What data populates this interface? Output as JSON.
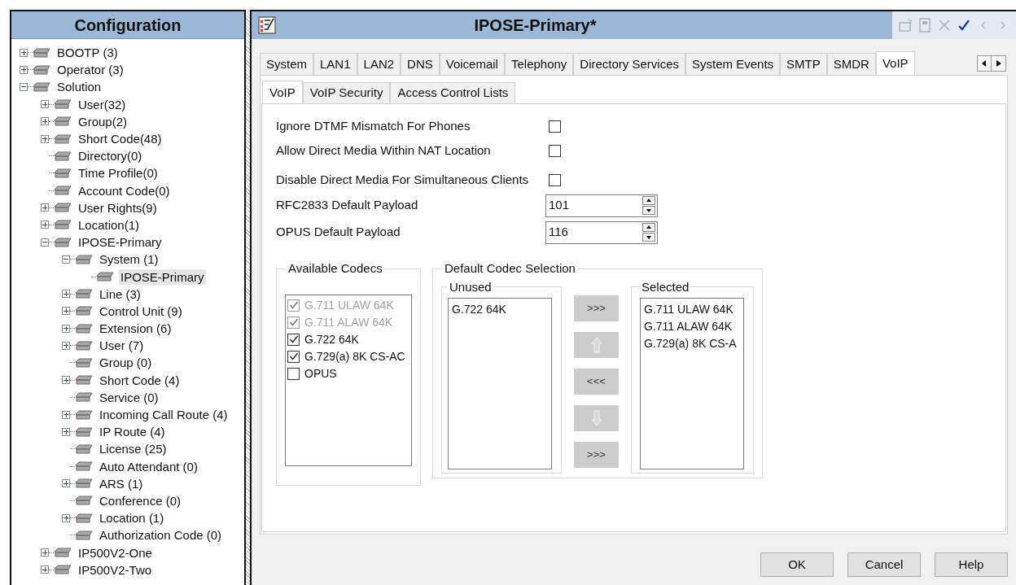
{
  "left_panel": {
    "title": "Configuration",
    "tree": [
      {
        "label": "BOOTP (3)",
        "expanded": false,
        "selected": false
      },
      {
        "label": "Operator (3)",
        "expanded": false,
        "selected": false
      },
      {
        "label": "Solution",
        "expanded": true,
        "selected": false,
        "children": [
          {
            "label": "User(32)",
            "expanded": false,
            "selected": false
          },
          {
            "label": "Group(2)",
            "expanded": false,
            "selected": false
          },
          {
            "label": "Short Code(48)",
            "expanded": false,
            "selected": false
          },
          {
            "label": "Directory(0)",
            "selected": false
          },
          {
            "label": "Time Profile(0)",
            "selected": false
          },
          {
            "label": "Account Code(0)",
            "selected": false
          },
          {
            "label": "User Rights(9)",
            "expanded": false,
            "selected": false
          },
          {
            "label": "Location(1)",
            "expanded": false,
            "selected": false
          },
          {
            "label": "IPOSE-Primary",
            "expanded": true,
            "selected": false,
            "children": [
              {
                "label": "System (1)",
                "expanded": true,
                "selected": false,
                "children": [
                  {
                    "label": "IPOSE-Primary",
                    "selected": true
                  }
                ]
              },
              {
                "label": "Line (3)",
                "expanded": false,
                "selected": false
              },
              {
                "label": "Control Unit (9)",
                "expanded": false,
                "selected": false
              },
              {
                "label": "Extension (6)",
                "expanded": false,
                "selected": false
              },
              {
                "label": "User (7)",
                "expanded": false,
                "selected": false
              },
              {
                "label": "Group (0)",
                "selected": false
              },
              {
                "label": "Short Code (4)",
                "expanded": false,
                "selected": false
              },
              {
                "label": "Service (0)",
                "selected": false
              },
              {
                "label": "Incoming Call Route (4)",
                "expanded": false,
                "selected": false
              },
              {
                "label": "IP Route (4)",
                "expanded": false,
                "selected": false
              },
              {
                "label": "License (25)",
                "selected": false
              },
              {
                "label": "Auto Attendant (0)",
                "selected": false
              },
              {
                "label": "ARS (1)",
                "expanded": false,
                "selected": false
              },
              {
                "label": "Conference (0)",
                "selected": false
              },
              {
                "label": "Location (1)",
                "expanded": false,
                "selected": false
              },
              {
                "label": "Authorization Code (0)",
                "selected": false
              }
            ]
          },
          {
            "label": "IP500V2-One",
            "expanded": false,
            "selected": false
          },
          {
            "label": "IP500V2-Two",
            "expanded": false,
            "selected": false
          }
        ]
      }
    ]
  },
  "editor": {
    "title": "IPOSE-Primary*",
    "toolbar": [
      {
        "kind": "new",
        "disabled": true
      },
      {
        "kind": "save",
        "disabled": true
      },
      {
        "kind": "delete",
        "disabled": true
      },
      {
        "kind": "validate",
        "disabled": false
      },
      {
        "kind": "back",
        "disabled": true
      },
      {
        "kind": "forward",
        "disabled": true
      }
    ],
    "tabs": [
      {
        "label": "System",
        "selected": false
      },
      {
        "label": "LAN1",
        "selected": false
      },
      {
        "label": "LAN2",
        "selected": false
      },
      {
        "label": "DNS",
        "selected": false
      },
      {
        "label": "Voicemail",
        "selected": false
      },
      {
        "label": "Telephony",
        "selected": false
      },
      {
        "label": "Directory Services",
        "selected": false
      },
      {
        "label": "System Events",
        "selected": false
      },
      {
        "label": "SMTP",
        "selected": false
      },
      {
        "label": "SMDR",
        "selected": false
      },
      {
        "label": "VoIP",
        "selected": true
      }
    ],
    "subtabs": [
      {
        "label": "VoIP",
        "selected": true
      },
      {
        "label": "VoIP Security",
        "selected": false
      },
      {
        "label": "Access Control Lists",
        "selected": false
      }
    ],
    "settings": [
      {
        "kind": "checkbox",
        "label": "Ignore DTMF Mismatch For Phones",
        "checked": false
      },
      {
        "kind": "checkbox",
        "label": "Allow Direct Media Within NAT Location",
        "checked": false
      },
      {
        "kind": "checkbox",
        "label": "Disable Direct Media For Simultaneous Clients",
        "checked": false
      },
      {
        "kind": "spinner",
        "label": "RFC2833 Default Payload",
        "value": "101"
      },
      {
        "kind": "spinner",
        "label": "OPUS Default Payload",
        "value": "116"
      }
    ],
    "available_codecs": {
      "title": "Available Codecs",
      "items": [
        {
          "label": "G.711 ULAW 64K",
          "checked": true,
          "disabled": true
        },
        {
          "label": "G.711 ALAW 64K",
          "checked": true,
          "disabled": true
        },
        {
          "label": "G.722 64K",
          "checked": true,
          "disabled": false
        },
        {
          "label": "G.729(a) 8K CS-AC",
          "checked": true,
          "disabled": false
        },
        {
          "label": "OPUS",
          "checked": false,
          "disabled": false
        }
      ]
    },
    "codec_selection": {
      "title": "Default Codec Selection",
      "unused": {
        "title": "Unused",
        "items": [
          "G.722 64K"
        ]
      },
      "selected": {
        "title": "Selected",
        "items": [
          "G.711 ULAW 64K",
          "G.711 ALAW 64K",
          "G.729(a) 8K CS-A"
        ]
      },
      "buttons": [
        {
          "kind": "text",
          "label": ">>>"
        },
        {
          "kind": "up"
        },
        {
          "kind": "text",
          "label": "<<<"
        },
        {
          "kind": "down"
        },
        {
          "kind": "text",
          "label": ">>>"
        }
      ]
    }
  },
  "buttons": [
    "OK",
    "Cancel",
    "Help"
  ]
}
